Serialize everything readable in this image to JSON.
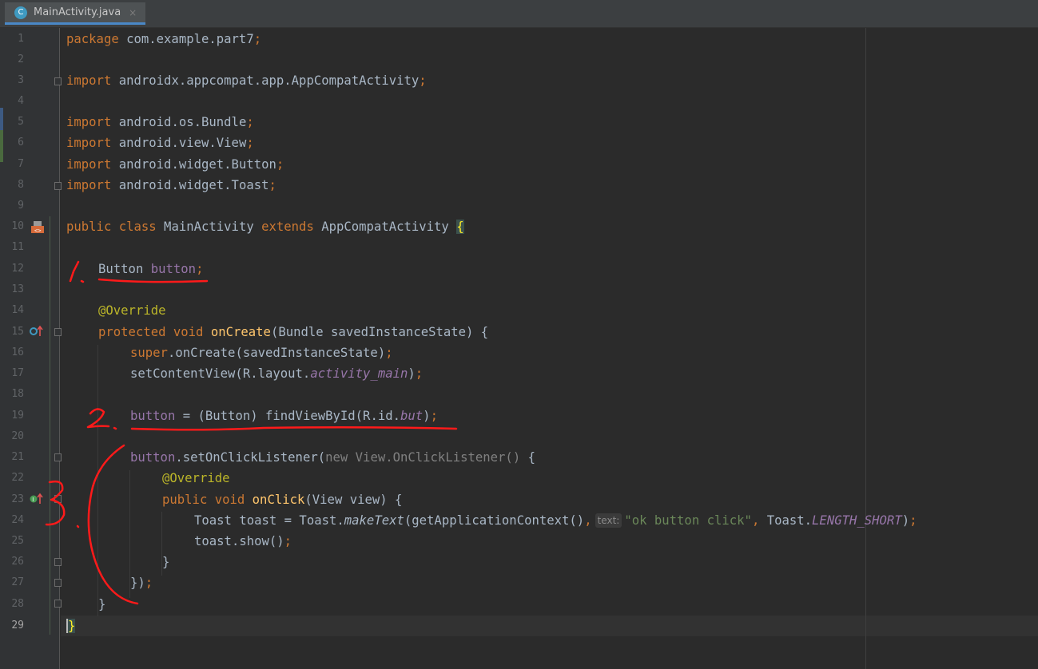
{
  "tab": {
    "icon_letter": "C",
    "title": "MainActivity.java",
    "close": "×"
  },
  "gutter": {
    "line_numbers": [
      "1",
      "2",
      "3",
      "4",
      "5",
      "6",
      "7",
      "8",
      "9",
      "10",
      "11",
      "12",
      "13",
      "14",
      "15",
      "16",
      "17",
      "18",
      "19",
      "20",
      "21",
      "22",
      "23",
      "24",
      "25",
      "26",
      "27",
      "28",
      "29"
    ],
    "current_line": "29"
  },
  "code": {
    "l1": {
      "kw": "package",
      "rest": " com.example.part7",
      "semi": ";"
    },
    "l3": {
      "kw": "import",
      "rest": " androidx.appcompat.app.AppCompatActivity",
      "semi": ";"
    },
    "l5": {
      "kw": "import",
      "rest": " android.os.Bundle",
      "semi": ";"
    },
    "l6": {
      "kw": "import",
      "rest": " android.view.View",
      "semi": ";"
    },
    "l7": {
      "kw": "import",
      "rest": " android.widget.Button",
      "semi": ";"
    },
    "l8": {
      "kw": "import",
      "rest": " android.widget.Toast",
      "semi": ";"
    },
    "l10": {
      "kw1": "public class",
      "name": " MainActivity ",
      "kw2": "extends",
      "rest": " AppCompatActivity ",
      "brace": "{"
    },
    "l12": {
      "type": "Button ",
      "field": "button",
      "semi": ";"
    },
    "l14": {
      "ann": "@Override"
    },
    "l15": {
      "kw": "protected void ",
      "fn": "onCreate",
      "rest": "(Bundle savedInstanceState) {"
    },
    "l16": {
      "kw": "super",
      "rest": ".onCreate(savedInstanceState)",
      "semi": ";"
    },
    "l17": {
      "pre": "setContentView(R.layout.",
      "field": "activity_main",
      "post": ")",
      "semi": ";"
    },
    "l19": {
      "field": "button",
      "pre": " = (Button) findViewById(R.id.",
      "ifield": "but",
      "post": ")",
      "semi": ";"
    },
    "l21": {
      "field": "button",
      "pre": ".setOnClickListener(",
      "gray": "new View.OnClickListener()",
      "post": " {"
    },
    "l22": {
      "ann": "@Override"
    },
    "l23": {
      "kw": "public void ",
      "fn": "onClick",
      "rest": "(View view) {"
    },
    "l24": {
      "pre": "Toast toast = Toast.",
      "ital": "makeText",
      "mid": "(getApplicationContext()",
      "comma1": ",",
      "hint": "text:",
      "str": "\"ok button click\"",
      "comma2": ",",
      "cls": " Toast.",
      "ifield": "LENGTH_SHORT",
      "post": ")",
      "semi": ";"
    },
    "l25": {
      "pre": "toast.show()",
      "semi": ";"
    },
    "l26": {
      "text": "}"
    },
    "l27": {
      "pre": "})",
      "semi": ";"
    },
    "l28": {
      "text": "}"
    },
    "l29": {
      "text": "}"
    }
  },
  "annotations": {
    "mark1": "1.",
    "mark2": "2.",
    "mark3": "3"
  },
  "colors": {
    "background": "#2b2b2b",
    "keyword": "#cc7832",
    "annotation": "#bbb529",
    "field": "#9876aa",
    "method": "#ffc66d",
    "string": "#6a8759",
    "ink": "#ff1a1a"
  }
}
